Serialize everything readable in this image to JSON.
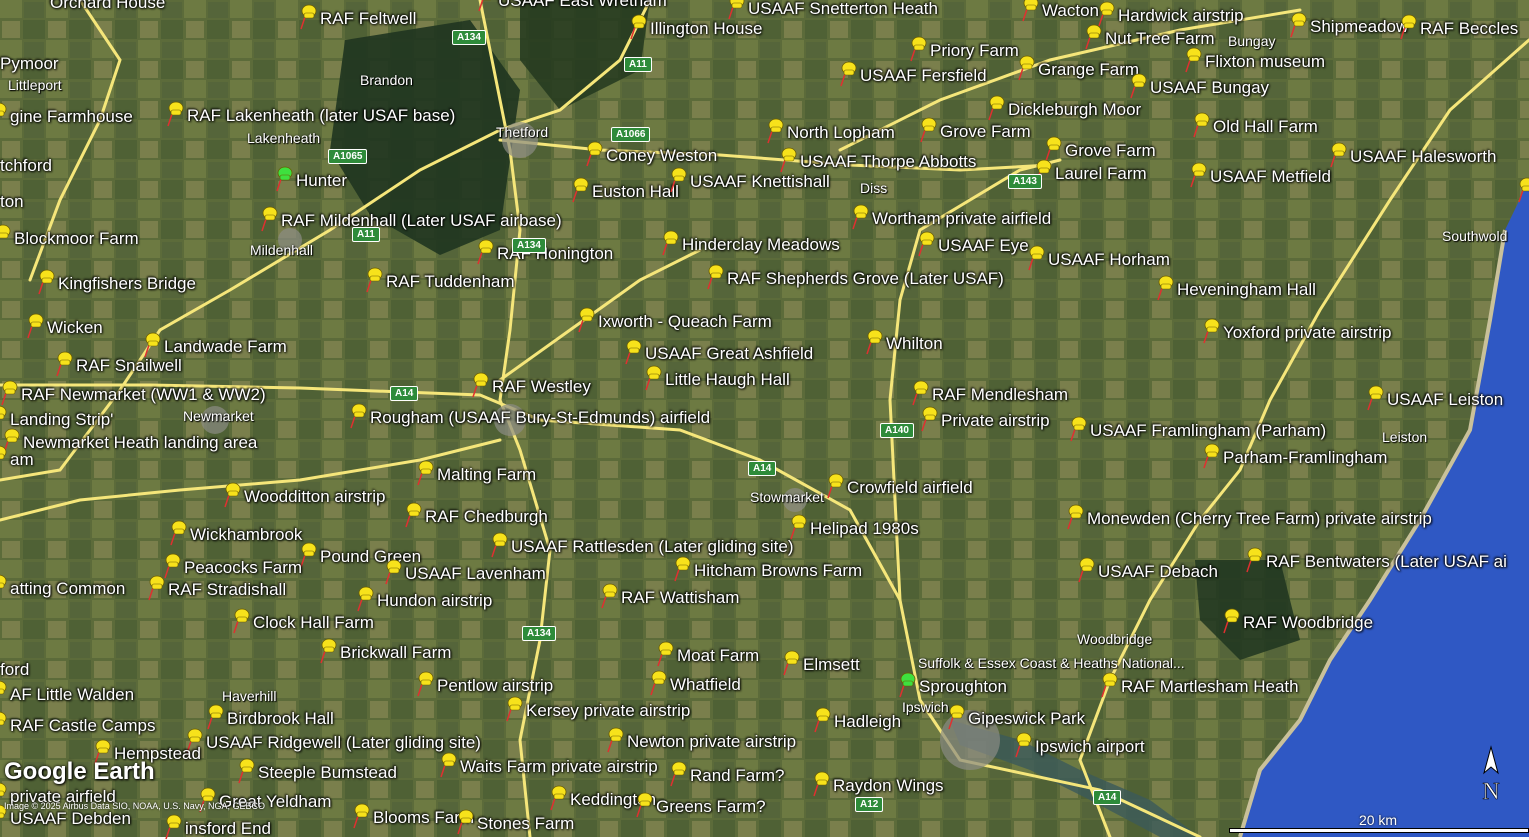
{
  "colors": {
    "pin_yellow": "#f7e21b",
    "pin_green": "#3ee03e",
    "road": "#f5e67a",
    "sea": "#2f58c4"
  },
  "app": {
    "logo": "Google Earth",
    "copyright": "Image © 2025 Airbus  Data SIO, NOAA, U.S. Navy, NGA, GEBCO"
  },
  "scale": {
    "label": "20 km"
  },
  "north": {
    "label": "N"
  },
  "roads": [
    "A134",
    "A11",
    "A1066",
    "A1065",
    "A14",
    "A143",
    "A140",
    "A12"
  ],
  "places": [
    {
      "text": "Orchard House",
      "pin": null
    },
    {
      "text": "RAF Feltwell",
      "pin": "yellow"
    },
    {
      "text": "USAAF East Wretham",
      "pin": "yellow"
    },
    {
      "text": "Illington House",
      "pin": "yellow"
    },
    {
      "text": "USAAF Snetterton Heath",
      "pin": "yellow"
    },
    {
      "text": "Wacton",
      "pin": "yellow"
    },
    {
      "text": "Hardwick airstrip",
      "pin": "yellow"
    },
    {
      "text": "Shipmeadow",
      "pin": "yellow"
    },
    {
      "text": "RAF Beccles",
      "pin": "yellow"
    },
    {
      "text": "Pymoor",
      "pin": null
    },
    {
      "text": "Priory Farm",
      "pin": "yellow"
    },
    {
      "text": "Nut Tree Farm",
      "pin": "yellow"
    },
    {
      "text": "Grange Farm",
      "pin": "yellow"
    },
    {
      "text": "Flixton museum",
      "pin": "yellow"
    },
    {
      "text": "USAAF Fersfield",
      "pin": "yellow"
    },
    {
      "text": "USAAF Bungay",
      "pin": "yellow"
    },
    {
      "text": "gine Farmhouse",
      "pin": "yellow"
    },
    {
      "text": "RAF Lakenheath (later USAF base)",
      "pin": "yellow"
    },
    {
      "text": "Dickleburgh Moor",
      "pin": "yellow"
    },
    {
      "text": "North Lopham",
      "pin": "yellow"
    },
    {
      "text": "Grove Farm",
      "pin": "yellow"
    },
    {
      "text": "Old Hall Farm",
      "pin": "yellow"
    },
    {
      "text": "tchford",
      "pin": null
    },
    {
      "text": "Coney Weston",
      "pin": "yellow"
    },
    {
      "text": "USAAF Thorpe Abbotts",
      "pin": "yellow"
    },
    {
      "text": "Grove Farm",
      "pin": "yellow"
    },
    {
      "text": "USAAF Halesworth",
      "pin": "yellow"
    },
    {
      "text": "Hunter",
      "pin": "green"
    },
    {
      "text": "Euston Hall",
      "pin": "yellow"
    },
    {
      "text": "USAAF Knettishall",
      "pin": "yellow"
    },
    {
      "text": "Laurel Farm",
      "pin": "yellow"
    },
    {
      "text": "USAAF Metfield",
      "pin": "yellow"
    },
    {
      "text": "ton",
      "pin": null
    },
    {
      "text": "RAF Mildenhall (Later USAF airbase)",
      "pin": "yellow"
    },
    {
      "text": "Wortham private airfield",
      "pin": "yellow"
    },
    {
      "text": "Eas",
      "pin": "yellow"
    },
    {
      "text": "Blockmoor Farm",
      "pin": "yellow"
    },
    {
      "text": "Hinderclay Meadows",
      "pin": "yellow"
    },
    {
      "text": "USAAF Eye",
      "pin": "yellow"
    },
    {
      "text": "RAF Honington",
      "pin": "yellow"
    },
    {
      "text": "USAAF Horham",
      "pin": "yellow"
    },
    {
      "text": "RAF Shepherds Grove (Later USAF)",
      "pin": "yellow"
    },
    {
      "text": "Kingfishers Bridge",
      "pin": "yellow"
    },
    {
      "text": "RAF Tuddenham",
      "pin": "yellow"
    },
    {
      "text": "Heveningham Hall",
      "pin": "yellow"
    },
    {
      "text": "Ixworth - Queach Farm",
      "pin": "yellow"
    },
    {
      "text": "Wicken",
      "pin": "yellow"
    },
    {
      "text": "Yoxford private airstrip",
      "pin": "yellow"
    },
    {
      "text": "Landwade Farm",
      "pin": "yellow"
    },
    {
      "text": "Whilton",
      "pin": "yellow"
    },
    {
      "text": "USAAF Great Ashfield",
      "pin": "yellow"
    },
    {
      "text": "RAF Snailwell",
      "pin": "yellow"
    },
    {
      "text": "Little Haugh Hall",
      "pin": "yellow"
    },
    {
      "text": "RAF Westley",
      "pin": "yellow"
    },
    {
      "text": "RAF Newmarket (WW1 & WW2)",
      "pin": "yellow"
    },
    {
      "text": "RAF Mendlesham",
      "pin": "yellow"
    },
    {
      "text": "USAAF Leiston",
      "pin": "yellow"
    },
    {
      "text": "Landing Strip'",
      "pin": "yellow"
    },
    {
      "text": "Rougham (USAAF Bury-St-Edmunds) airfield",
      "pin": "yellow"
    },
    {
      "text": "Private airstrip",
      "pin": "yellow"
    },
    {
      "text": "USAAF Framlingham (Parham)",
      "pin": "yellow"
    },
    {
      "text": "Newmarket Heath landing area",
      "pin": "yellow"
    },
    {
      "text": "Parham-Framlingham",
      "pin": "yellow"
    },
    {
      "text": "am",
      "pin": "yellow"
    },
    {
      "text": "Malting Farm",
      "pin": "yellow"
    },
    {
      "text": "Crowfield airfield",
      "pin": "yellow"
    },
    {
      "text": "Woodditton airstrip",
      "pin": "yellow"
    },
    {
      "text": "RAF Chedburgh",
      "pin": "yellow"
    },
    {
      "text": "Monewden (Cherry Tree Farm) private airstrip",
      "pin": "yellow"
    },
    {
      "text": "Wickhambrook",
      "pin": "yellow"
    },
    {
      "text": "Helipad 1980s",
      "pin": "yellow"
    },
    {
      "text": "USAAF Rattlesden (Later gliding site)",
      "pin": "yellow"
    },
    {
      "text": "Pound Green",
      "pin": "yellow"
    },
    {
      "text": "Peacocks Farm",
      "pin": "yellow"
    },
    {
      "text": "Hitcham Browns Farm",
      "pin": "yellow"
    },
    {
      "text": "USAAF Debach",
      "pin": "yellow"
    },
    {
      "text": "RAF Bentwaters (Later USAF ai",
      "pin": "yellow"
    },
    {
      "text": "USAAF Lavenham",
      "pin": "yellow"
    },
    {
      "text": "atting Common",
      "pin": "yellow"
    },
    {
      "text": "RAF Stradishall",
      "pin": "yellow"
    },
    {
      "text": "RAF Wattisham",
      "pin": "yellow"
    },
    {
      "text": "Hundon airstrip",
      "pin": "yellow"
    },
    {
      "text": "RAF Woodbridge",
      "pin": "yellow"
    },
    {
      "text": "Clock Hall Farm",
      "pin": "yellow"
    },
    {
      "text": "Brickwall Farm",
      "pin": "yellow"
    },
    {
      "text": "Moat Farm",
      "pin": "yellow"
    },
    {
      "text": "Elmsett",
      "pin": "yellow"
    },
    {
      "text": "ford",
      "pin": null
    },
    {
      "text": "Pentlow airstrip",
      "pin": "yellow"
    },
    {
      "text": "Whatfield",
      "pin": "yellow"
    },
    {
      "text": "Sproughton",
      "pin": "green"
    },
    {
      "text": "RAF Martlesham Heath",
      "pin": "yellow"
    },
    {
      "text": "AF Little Walden",
      "pin": "yellow"
    },
    {
      "text": "Kersey private airstrip",
      "pin": "yellow"
    },
    {
      "text": "Birdbrook Hall",
      "pin": "yellow"
    },
    {
      "text": "Gipeswick Park",
      "pin": "yellow"
    },
    {
      "text": "Hadleigh",
      "pin": "yellow"
    },
    {
      "text": "RAF Castle Camps",
      "pin": "yellow"
    },
    {
      "text": "USAAF Ridgewell (Later gliding site)",
      "pin": "yellow"
    },
    {
      "text": "Newton private airstrip",
      "pin": "yellow"
    },
    {
      "text": "Ipswich airport",
      "pin": "yellow"
    },
    {
      "text": "Hempstead",
      "pin": "yellow"
    },
    {
      "text": "Waits Farm private airstrip",
      "pin": "yellow"
    },
    {
      "text": "Steeple Bumstead",
      "pin": "yellow"
    },
    {
      "text": "Rand Farm?",
      "pin": "yellow"
    },
    {
      "text": "Raydon Wings",
      "pin": "yellow"
    },
    {
      "text": "private airfield",
      "pin": "yellow"
    },
    {
      "text": "USAAF Debden",
      "pin": "yellow"
    },
    {
      "text": "Great Yeldham",
      "pin": "yellow"
    },
    {
      "text": "Keddington",
      "pin": "yellow"
    },
    {
      "text": "Greens Farm?",
      "pin": "yellow"
    },
    {
      "text": "Blooms Farm",
      "pin": "yellow"
    },
    {
      "text": "Stones Farm",
      "pin": "yellow"
    },
    {
      "text": "insford End",
      "pin": "yellow"
    }
  ],
  "towns": [
    "Littleport",
    "Brandon",
    "Lakenheath",
    "Thetford",
    "Diss",
    "Bungay",
    "Mildenhall",
    "Southwold",
    "Newmarket",
    "Leiston",
    "Stowmarket",
    "Woodbridge",
    "Haverhill",
    "Suffolk & Essex Coast & Heaths National...",
    "Ipswich"
  ]
}
